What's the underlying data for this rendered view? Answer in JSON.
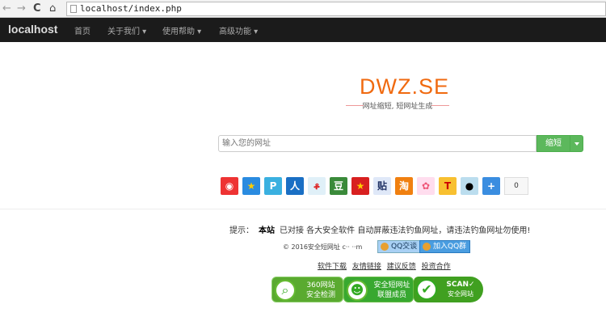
{
  "browser": {
    "url": "localhost/index.php"
  },
  "nav": {
    "brand": "localhost",
    "items": [
      "首页",
      "关于我们 ▾",
      "使用帮助 ▾",
      "高级功能 ▾"
    ]
  },
  "logo": {
    "text": "DWZ.SE",
    "slogan": "网址缩短, 短网址生成"
  },
  "form": {
    "placeholder": "输入您的网址",
    "submit": "缩短"
  },
  "share": {
    "icons": [
      "weibo-icon",
      "qzone-icon",
      "tencent-weibo-icon",
      "renren-icon",
      "netease-icon",
      "douban-icon",
      "kaixin-icon",
      "tieba-icon",
      "taobao-icon",
      "pengyou-icon",
      "t-icon",
      "qq-icon",
      "more-icon"
    ],
    "count": "0"
  },
  "tip": {
    "label": "提示：",
    "strong": "本站",
    "text": "已对接 各大安全软件 自动屏蔽违法钓鱼网址，请违法钓鱼网址勿使用!"
  },
  "footer": {
    "copyright": "© 2016安全短网址 c·· ··m",
    "qq_chat": "QQ交谈",
    "qq_group": "加入QQ群",
    "links": [
      "软件下载",
      "友情链接",
      "建议反馈",
      "投资合作"
    ]
  },
  "badges": [
    {
      "line1": "360网站",
      "line2": "安全检测"
    },
    {
      "line1": "安全短网址",
      "line2": "联盟成员"
    },
    {
      "line1": "SCAN✓",
      "line2": "安全网站"
    }
  ]
}
